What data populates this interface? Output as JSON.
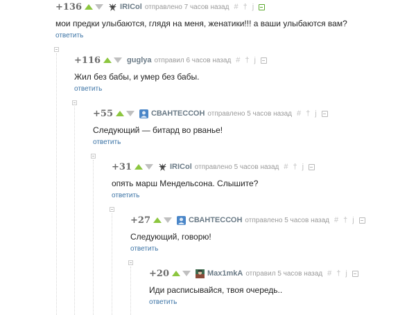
{
  "comments": [
    {
      "rating": "+136",
      "author": "IRICol",
      "meta": "отправлено 7 часов назад",
      "hash": "#",
      "text": "мои предки улыбаются, глядя на меня, женатики!!! а ваши улыбаются вам?",
      "reply": "ответить",
      "avatar": "chevron-star-icon",
      "saved": true
    },
    {
      "rating": "+116",
      "author": "guglya",
      "meta": "отправил 6 часов назад",
      "hash": "#",
      "text": "Жил без бабы, и умер без бабы.",
      "reply": "ответить",
      "avatar": "none",
      "saved": false
    },
    {
      "rating": "+55",
      "author": "СВАНТЕССОН",
      "meta": "отправлено 5 часов назад",
      "hash": "#",
      "text": "Следующий — битард во рванье!",
      "reply": "ответить",
      "avatar": "blue-avatar-icon",
      "saved": false
    },
    {
      "rating": "+31",
      "author": "IRICol",
      "meta": "отправлено 5 часов назад",
      "hash": "#",
      "text": "опять марш Мендельсона. Слышите?",
      "reply": "ответить",
      "avatar": "chevron-star-icon",
      "saved": false
    },
    {
      "rating": "+27",
      "author": "СВАНТЕССОН",
      "meta": "отправлено 5 часов назад",
      "hash": "#",
      "text": "Следующий, говорю!",
      "reply": "ответить",
      "avatar": "blue-avatar-icon",
      "saved": false
    },
    {
      "rating": "+20",
      "author": "Max1mkA",
      "meta": "отправил 5 часов назад",
      "hash": "#",
      "text": "Иди расписывайся, твоя очередь..",
      "reply": "ответить",
      "avatar": "photo-avatar-icon",
      "saved": false
    }
  ],
  "colors": {
    "accent_green": "#8cc63f",
    "link_blue": "#3b73a5",
    "author_gray": "#6a7a86"
  }
}
